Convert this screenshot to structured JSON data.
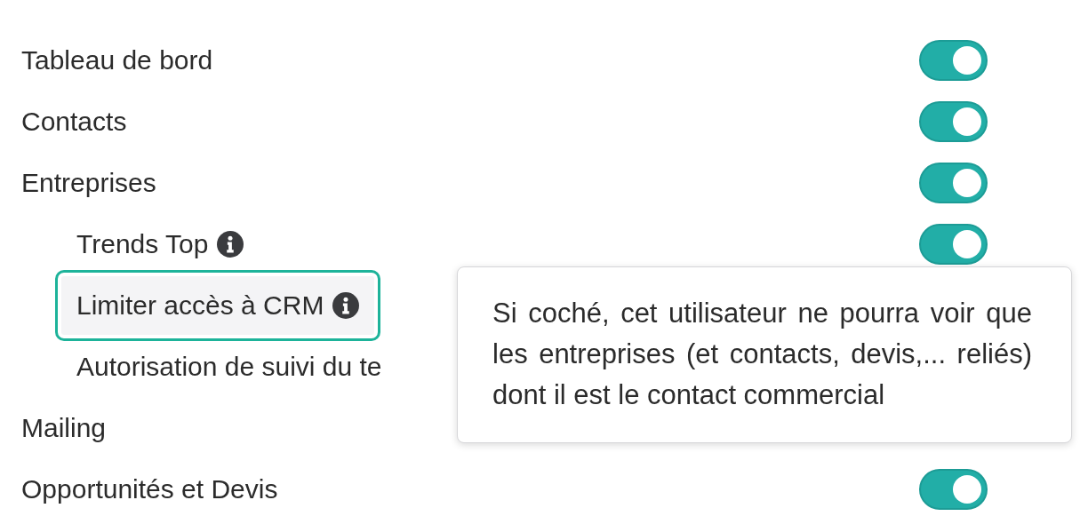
{
  "items": [
    {
      "label": "Tableau de bord",
      "toggle_on": true
    },
    {
      "label": "Contacts",
      "toggle_on": true
    },
    {
      "label": "Entreprises",
      "toggle_on": true,
      "children": [
        {
          "label": "Trends Top",
          "info": true,
          "highlighted": false,
          "toggle_on": true
        },
        {
          "label": "Limiter accès à CRM",
          "info": true,
          "highlighted": true
        },
        {
          "label": "Autorisation de suivi du te",
          "info": false,
          "highlighted": false
        }
      ]
    },
    {
      "label": "Mailing"
    },
    {
      "label": "Opportunités et Devis",
      "toggle_on": true
    }
  ],
  "tooltip": {
    "text": "Si coché, cet utilisateur ne pourra voir que les entreprises (et contacts, devis,... reliés) dont il est le contact commercial"
  }
}
